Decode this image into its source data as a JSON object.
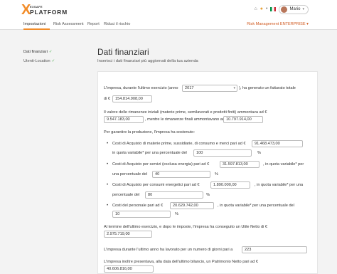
{
  "header": {
    "logo_top": "EXSAFE",
    "logo_main": "PLATFORM",
    "user_name": "Mario"
  },
  "nav": {
    "tabs": [
      "Impostazioni",
      "Risk Assessment",
      "Report",
      "Riduci il rischio"
    ],
    "menu": "Risk Management ENTERPRISE"
  },
  "sidebar": {
    "items": [
      {
        "label": "Dati finanziari",
        "checked": true
      },
      {
        "label": "Utenti-Location",
        "checked": true
      }
    ]
  },
  "page": {
    "title": "Dati finanziari",
    "subtitle": "Inserisci i dati finanziari più aggiornati della tua azienda"
  },
  "form": {
    "p1_a": "L'impresa, durante l'ultimo esercizio (anno",
    "year": "2017",
    "p1_b": "), ha generato un fatturato totale",
    "p1_c": "di €",
    "fatturato": "154.814.908,00",
    "p2_a": "Il valore delle rimanenze iniziali (materie prime, semilavorati e prodotti finiti) ammontava ad €",
    "rim_iniziali": "9.547.183,00",
    "p2_b": ", mentre le rimanenze finali ammontavano ad €",
    "rim_finali": "10.797.914,00",
    "p3": "Per garantire la produzione, l'impresa ha sostenuto:",
    "b1_a": "Costi di Acquisto di materie prime, sussidiarie, di consumo e merci pari ad €",
    "b1_val": "91.468.473,00",
    "b1_b": "in quota variabile* per una percentuale del",
    "b1_pct": "100",
    "b2_a": "Costi di Acquisto per servizi (esclusa energia) pari ad €",
    "b2_val": "31.597.813,00",
    "b2_b": ", in quota variabile* per",
    "b2_c": "una percentuale del",
    "b2_pct": "40",
    "b3_a": "Costi di Acquisto per consumi energetici pari ad €",
    "b3_val": "1.890.000,00",
    "b3_b": ", in quota variabile* per una",
    "b3_c": "percentuale del",
    "b3_pct": "80",
    "b4_a": "Costi del personale pari ad €",
    "b4_val": "20.629.742,00",
    "b4_b": ", in quota variabile* per una percentuale del",
    "b4_pct": "10",
    "pct_sign": "%",
    "p4_a": "Al termine dell'ultimo esercizio, e dopo le imposte, l'impresa ha conseguito un Utile Netto di €",
    "utile": "2.975.719,00",
    "p5_a": "L'impresa durante l'ultimo anno ha lavorato per un numero di giorni pari a",
    "giorni": "223",
    "p6_a": "L'impresa inoltre presentava, alla data dell'ultimo bilancio, un Patrimonio Netto pari ad €",
    "patrimonio": "40.606.816,00"
  },
  "colors": {
    "accent": "#f28c28",
    "check": "#4caf50",
    "menu": "#d05a20"
  }
}
